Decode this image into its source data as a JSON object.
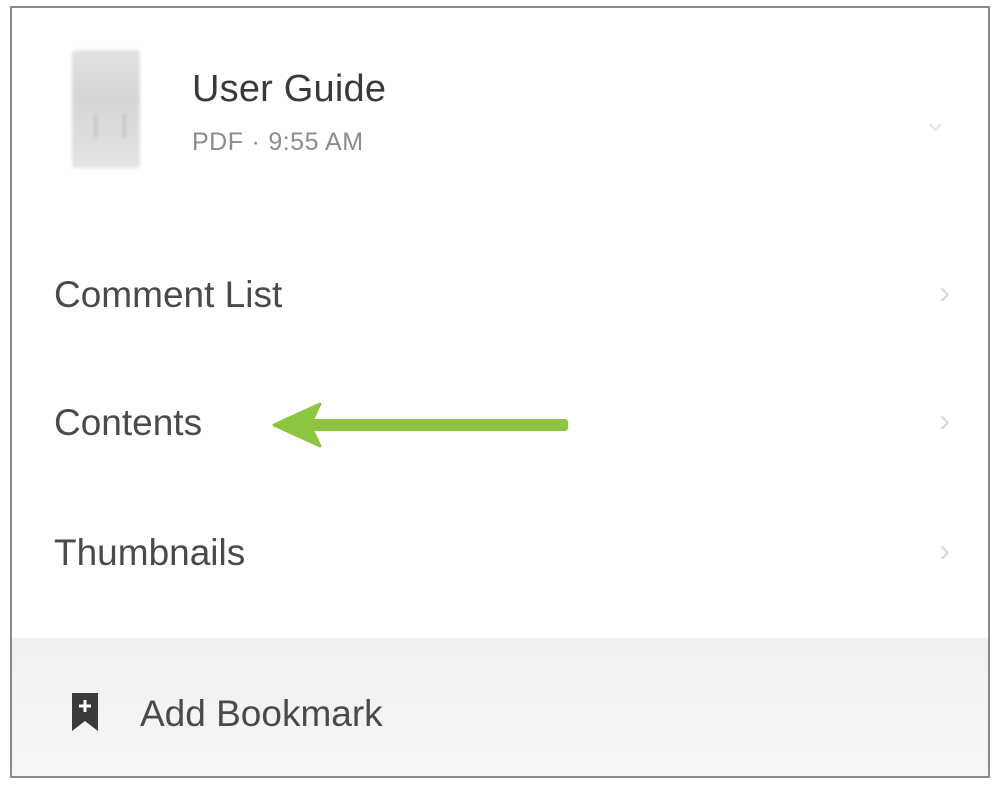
{
  "document": {
    "title": "User Guide",
    "type": "PDF",
    "separator": "·",
    "time": "9:55 AM"
  },
  "menu": {
    "items": [
      {
        "label": "Comment List"
      },
      {
        "label": "Contents"
      },
      {
        "label": "Thumbnails"
      }
    ]
  },
  "footer": {
    "add_bookmark_label": "Add Bookmark"
  },
  "icons": {
    "header_chevron": "chevron-down-icon",
    "item_chevron": "chevron-right-icon",
    "bookmark": "bookmark-add-icon",
    "annotation": "arrow-left-icon"
  },
  "colors": {
    "annotation_arrow": "#8cc63f",
    "text_primary": "#3a3a3a",
    "text_secondary": "#8c8c8c",
    "footer_bg": "#f2f2f2"
  }
}
